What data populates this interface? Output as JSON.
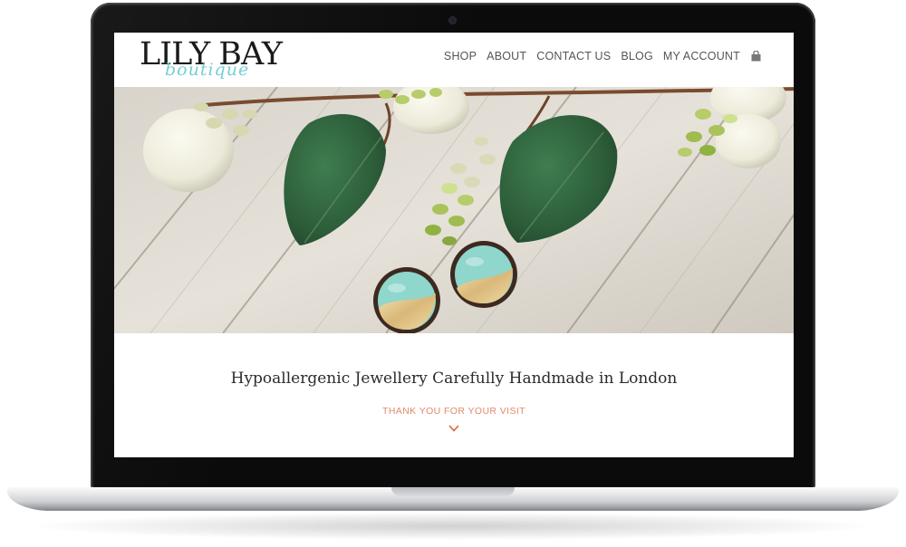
{
  "site": {
    "logo_main": "LILY BAY",
    "logo_script": "boutique",
    "logo_accent_color": "#74cfd3"
  },
  "nav": {
    "items": [
      {
        "label": "SHOP"
      },
      {
        "label": "ABOUT"
      },
      {
        "label": "CONTACT US"
      },
      {
        "label": "BLOG"
      },
      {
        "label": "MY ACCOUNT"
      }
    ],
    "cart_icon": "shopping-bag-icon"
  },
  "hero": {
    "image": "turquoise-gold-wooden-stud-earrings-with-leaves-and-berries-on-whitewashed-wood"
  },
  "content": {
    "tagline": "Hypoallergenic Jewellery Carefully Handmade in London",
    "subtext": "THANK YOU FOR YOUR VISIT",
    "subtext_color": "#e08a6a",
    "scroll_icon": "chevron-down-icon"
  }
}
